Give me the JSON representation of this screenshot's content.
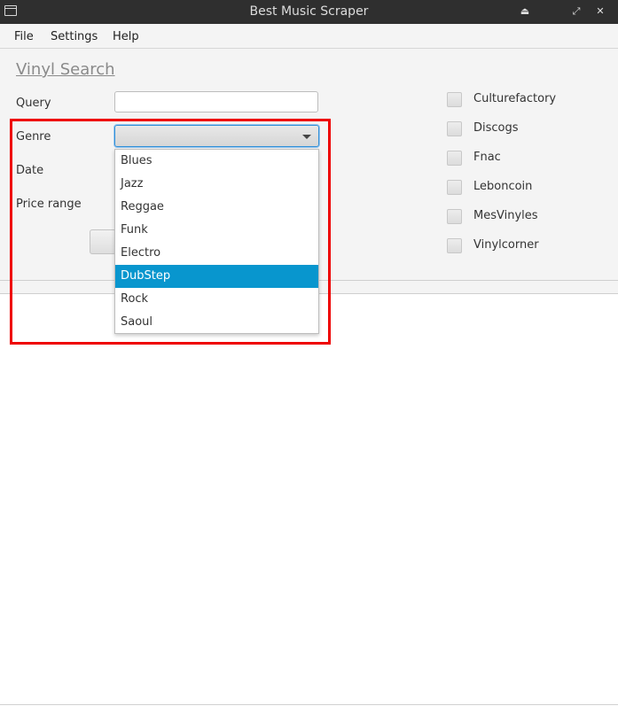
{
  "window": {
    "title": "Best Music Scraper"
  },
  "menu": [
    "File",
    "Settings",
    "Help"
  ],
  "form": {
    "section_title": "Vinyl Search",
    "query_label": "Query",
    "query_value": "",
    "genre_label": "Genre",
    "genre_value": "",
    "date_label": "Date",
    "price_label": "Price range"
  },
  "genre_options": [
    "Blues",
    "Jazz",
    "Reggae",
    "Funk",
    "Electro",
    "DubStep",
    "Rock",
    "Saoul"
  ],
  "genre_highlighted": "DubStep",
  "sources": [
    {
      "label": "Culturefactory",
      "checked": false
    },
    {
      "label": "Discogs",
      "checked": false
    },
    {
      "label": "Fnac",
      "checked": false
    },
    {
      "label": "Leboncoin",
      "checked": false
    },
    {
      "label": "MesVinyles",
      "checked": false
    },
    {
      "label": "Vinylcorner",
      "checked": false
    }
  ],
  "colors": {
    "selection": "#0896ce",
    "annotation": "#ee0000",
    "titlebar": "#2f2f2f"
  }
}
